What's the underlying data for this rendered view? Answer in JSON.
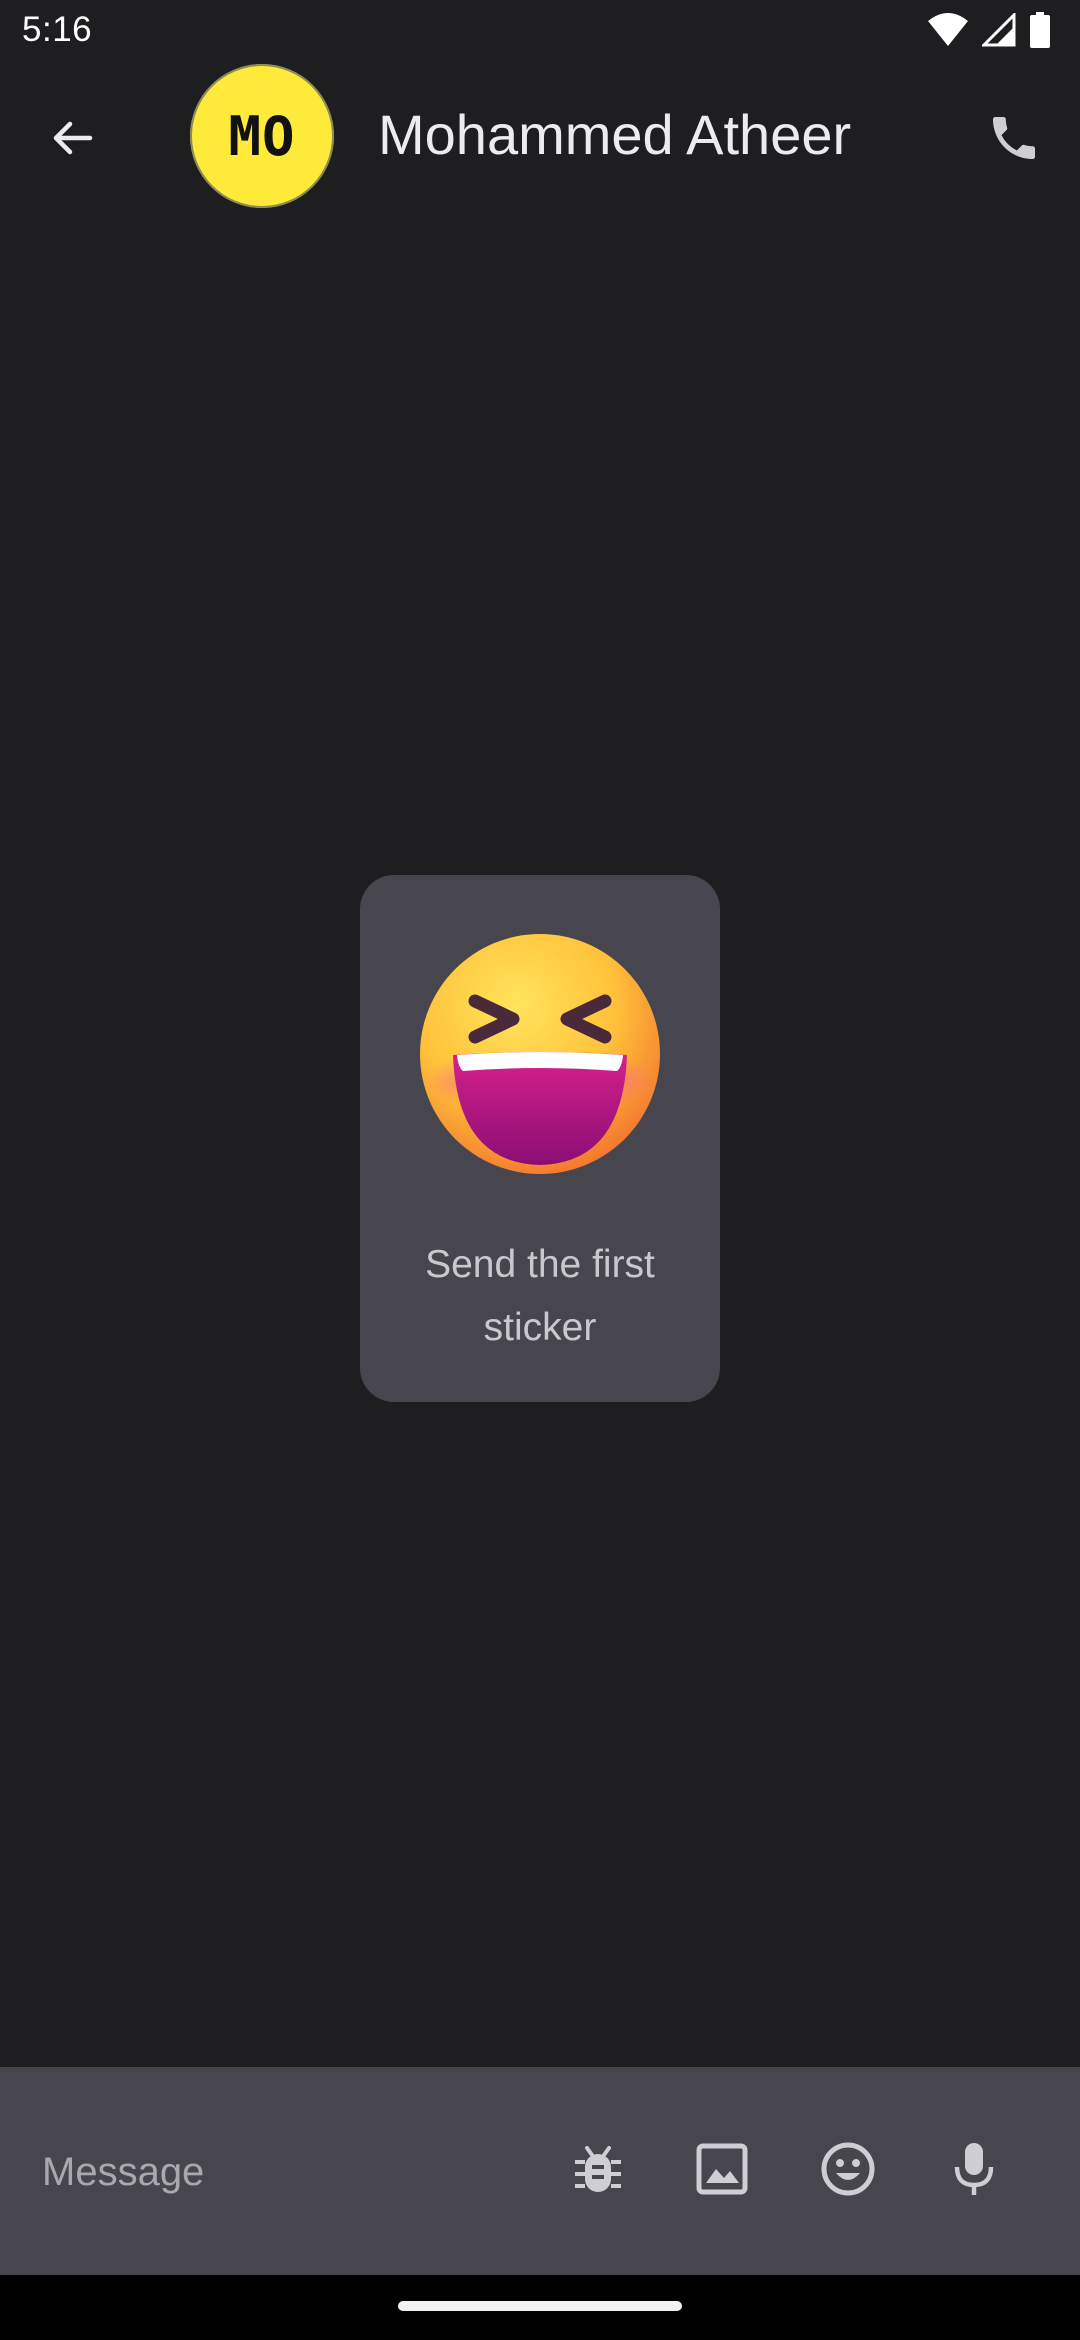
{
  "status_bar": {
    "time": "5:16",
    "icons": [
      "wifi-icon",
      "cellular-signal-icon",
      "battery-icon"
    ]
  },
  "header": {
    "back_icon": "arrow-back-icon",
    "avatar_initials": "MO",
    "avatar_color": "#ffea3a",
    "contact_name": "Mohammed Atheer",
    "call_icon": "phone-icon"
  },
  "empty_state": {
    "sticker_emoji": "grinning-squinting-face",
    "caption": "Send the first sticker"
  },
  "composer": {
    "placeholder": "Message",
    "value": "",
    "actions": [
      "bug-icon",
      "image-icon",
      "emoji-icon",
      "microphone-icon"
    ]
  },
  "colors": {
    "background": "#1e1e20",
    "surface": "#47464f",
    "avatar": "#ffea3a"
  }
}
